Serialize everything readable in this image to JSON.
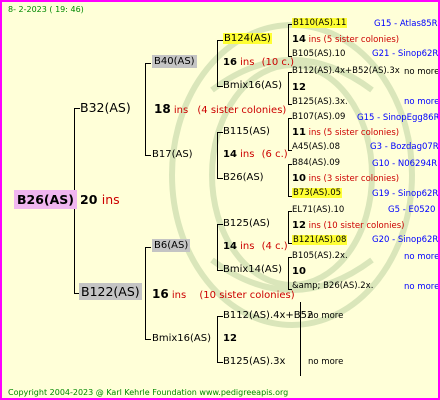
{
  "date": "8-  2-2023 ( 19: 46)",
  "footer": "Copyright 2004-2023 @ Karl Kehrle Foundation    www.pedigreeapis.org",
  "ins": "ins",
  "root": {
    "name": "B26(AS)",
    "num": "20"
  },
  "g1": {
    "top": {
      "name": "B32(AS)",
      "num": "18",
      "note": "(4 sister colonies)"
    },
    "bottom": {
      "name": "B122(AS)",
      "num": "16",
      "note": "(10 sister colonies)"
    }
  },
  "g2": {
    "a": {
      "name": "B40(AS)"
    },
    "b": {
      "name": "B17(AS)",
      "num": "14",
      "note": "(6 c.)"
    },
    "c": {
      "name": "B6(AS)",
      "num": "14",
      "note": "(4 c.)"
    },
    "d": {
      "name": "Bmix16(AS)",
      "num": "12"
    }
  },
  "g3": {
    "a1": {
      "name": "B124(AS)",
      "num": "16",
      "note": "(10 c.)"
    },
    "a2": {
      "name": "Bmix16(AS)",
      "num": "12"
    },
    "b1": {
      "name": "B115(AS)",
      "num": "14",
      "note": "(6 c.)"
    },
    "b2": {
      "name": "B26(AS)"
    },
    "c1": {
      "name": "B125(AS)",
      "num": "12",
      "note": "(10 sister colonies)"
    },
    "c2": {
      "name": "Bmix14(AS)",
      "num": "10"
    },
    "d1": {
      "name": "B112(AS).4x+B52",
      "more": "no more"
    },
    "d2": {
      "name": "B125(AS).3x",
      "more": "no more"
    }
  },
  "g4": [
    {
      "name": "B110(AS).11",
      "code": "G15 - Atlas85R",
      "highlight": true
    },
    {
      "num": "14",
      "note": "(5 sister colonies)"
    },
    {
      "name": "B105(AS).10",
      "code": "G21 - Sinop62R"
    },
    {
      "name": "B112(AS).4x+B52(AS).3x",
      "code": "no more"
    },
    {
      "num": "12"
    },
    {
      "name": "B125(AS).3x.",
      "code": "no more"
    },
    {
      "name": "B107(AS).09",
      "code": "G15 - SinopEgg86R"
    },
    {
      "num": "11",
      "note": "(5 sister colonies)"
    },
    {
      "name": "A45(AS).08",
      "code": "G3 - Bozdag07R"
    },
    {
      "name": "B84(AS).09",
      "code": "G10 - N06294R"
    },
    {
      "num": "10",
      "note": "(3 sister colonies)"
    },
    {
      "name": "B73(AS).05",
      "code": "G19 - Sinop62R",
      "highlight": true
    },
    {
      "name": "EL71(AS).10",
      "code": "G5 - E0520"
    },
    {
      "num": "12",
      "note": "(10 sister colonies)"
    },
    {
      "name": "B121(AS).08",
      "code": "G20 - Sinop62R",
      "highlight": true
    },
    {
      "name": "B105(AS).2x.",
      "code": "no more"
    },
    {
      "num": "10"
    },
    {
      "name": "&amp; B26(AS).2x.",
      "code": "no more"
    }
  ]
}
